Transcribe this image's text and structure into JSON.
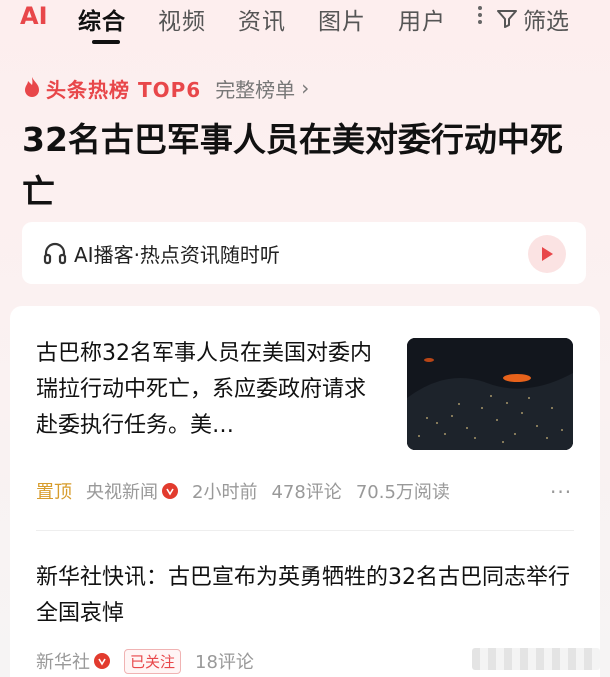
{
  "tabs": {
    "ai": "AI",
    "items": [
      "综合",
      "视频",
      "资讯",
      "图片",
      "用户"
    ],
    "filter": "筛选"
  },
  "hot": {
    "title": "头条热榜 TOP6",
    "full_list": "完整榜单",
    "headline": "32名古巴军事人员在美对委行动中死亡"
  },
  "podcast": {
    "text": "AI播客·热点资讯随时听"
  },
  "feed": {
    "item1": {
      "text": "古巴称32名军事人员在美国对委内瑞拉行动中死亡，系应委政府请求赴委执行任务。美…",
      "pinned": "置顶",
      "source": "央视新闻",
      "time": "2小时前",
      "comments": "478评论",
      "reads": "70.5万阅读"
    },
    "item2": {
      "text": "新华社快讯：古巴宣布为英勇牺牲的32名古巴同志举行全国哀悼",
      "source": "新华社",
      "followed": "已关注",
      "comments": "18评论"
    }
  },
  "colors": {
    "accent": "#e8474a",
    "pinned": "#d79c2c"
  }
}
